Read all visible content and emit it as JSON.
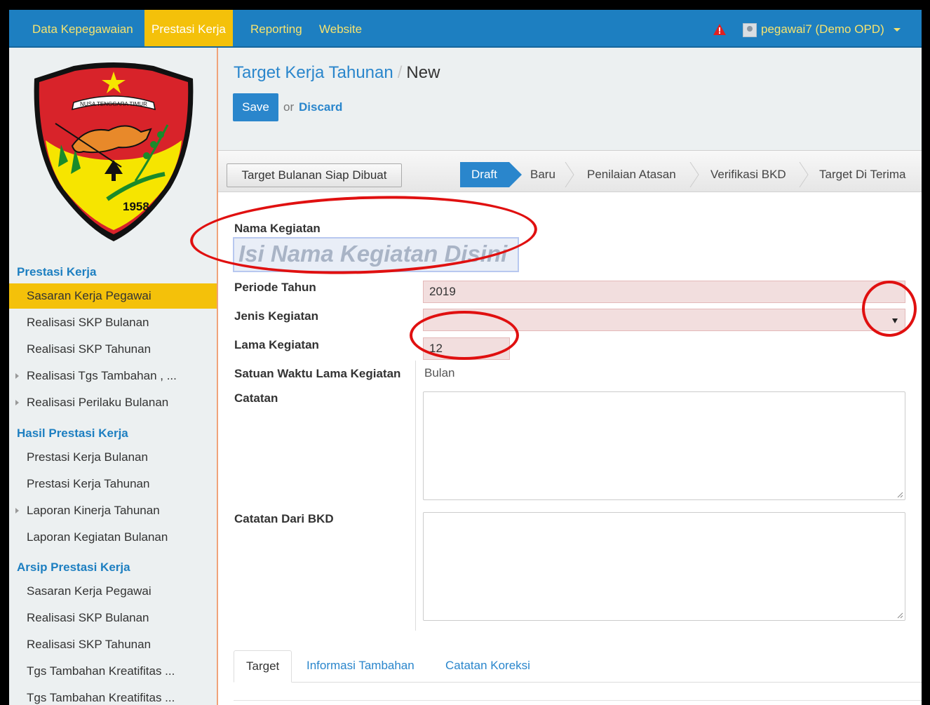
{
  "nav": {
    "items": [
      "Data Kepegawaian",
      "Prestasi Kerja",
      "Reporting",
      "Website"
    ],
    "active_index": 1,
    "user": "pegawai7 (Demo OPD)"
  },
  "logo": {
    "banner": "NUSA TENGGARA TIMUR",
    "year": "1958"
  },
  "sidebar": {
    "sections": [
      {
        "title": "Prestasi Kerja",
        "items": [
          {
            "label": "Sasaran Kerja Pegawai",
            "active": true,
            "expandable": false
          },
          {
            "label": "Realisasi SKP Bulanan",
            "active": false,
            "expandable": false
          },
          {
            "label": "Realisasi SKP Tahunan",
            "active": false,
            "expandable": false
          },
          {
            "label": "Realisasi Tgs Tambahan , ...",
            "active": false,
            "expandable": true
          },
          {
            "label": "Realisasi Perilaku Bulanan",
            "active": false,
            "expandable": true
          }
        ]
      },
      {
        "title": "Hasil Prestasi Kerja",
        "items": [
          {
            "label": "Prestasi Kerja Bulanan",
            "active": false,
            "expandable": false
          },
          {
            "label": "Prestasi Kerja Tahunan",
            "active": false,
            "expandable": false
          },
          {
            "label": "Laporan Kinerja Tahunan",
            "active": false,
            "expandable": true
          },
          {
            "label": "Laporan Kegiatan Bulanan",
            "active": false,
            "expandable": false
          }
        ]
      },
      {
        "title": "Arsip Prestasi Kerja",
        "items": [
          {
            "label": "Sasaran Kerja Pegawai",
            "active": false,
            "expandable": false
          },
          {
            "label": "Realisasi SKP Bulanan",
            "active": false,
            "expandable": false
          },
          {
            "label": "Realisasi SKP Tahunan",
            "active": false,
            "expandable": false
          },
          {
            "label": "Tgs Tambahan Kreatifitas ...",
            "active": false,
            "expandable": false
          },
          {
            "label": "Tgs Tambahan Kreatifitas ...",
            "active": false,
            "expandable": false
          }
        ]
      }
    ]
  },
  "breadcrumb": {
    "parent": "Target Kerja Tahunan",
    "separator": "/",
    "current": "New"
  },
  "actions": {
    "save": "Save",
    "or": "or",
    "discard": "Discard"
  },
  "statusbar": {
    "button": "Target Bulanan Siap Dibuat",
    "stages": [
      "Draft",
      "Baru",
      "Penilaian Atasan",
      "Verifikasi BKD",
      "Target Di Terima"
    ],
    "active_stage": "Draft"
  },
  "form": {
    "nama_kegiatan": {
      "label": "Nama Kegiatan",
      "placeholder": "Isi Nama Kegiatan Disini"
    },
    "periode_tahun": {
      "label": "Periode Tahun",
      "value": "2019"
    },
    "jenis_kegiatan": {
      "label": "Jenis Kegiatan",
      "value": ""
    },
    "lama_kegiatan": {
      "label": "Lama Kegiatan",
      "value": "12"
    },
    "satuan_waktu": {
      "label": "Satuan Waktu Lama Kegiatan",
      "value": "Bulan"
    },
    "catatan": {
      "label": "Catatan",
      "value": ""
    },
    "catatan_bkd": {
      "label": "Catatan Dari BKD",
      "value": ""
    }
  },
  "tabs": [
    "Target",
    "Informasi Tambahan",
    "Catatan Koreksi"
  ],
  "active_tab": "Target",
  "colors": {
    "nav_bg": "#1d7fc1",
    "active_yellow": "#f4c10a",
    "link_blue": "#2a86cc",
    "required_bg": "#f2dede",
    "annotation_red": "#e01010"
  }
}
